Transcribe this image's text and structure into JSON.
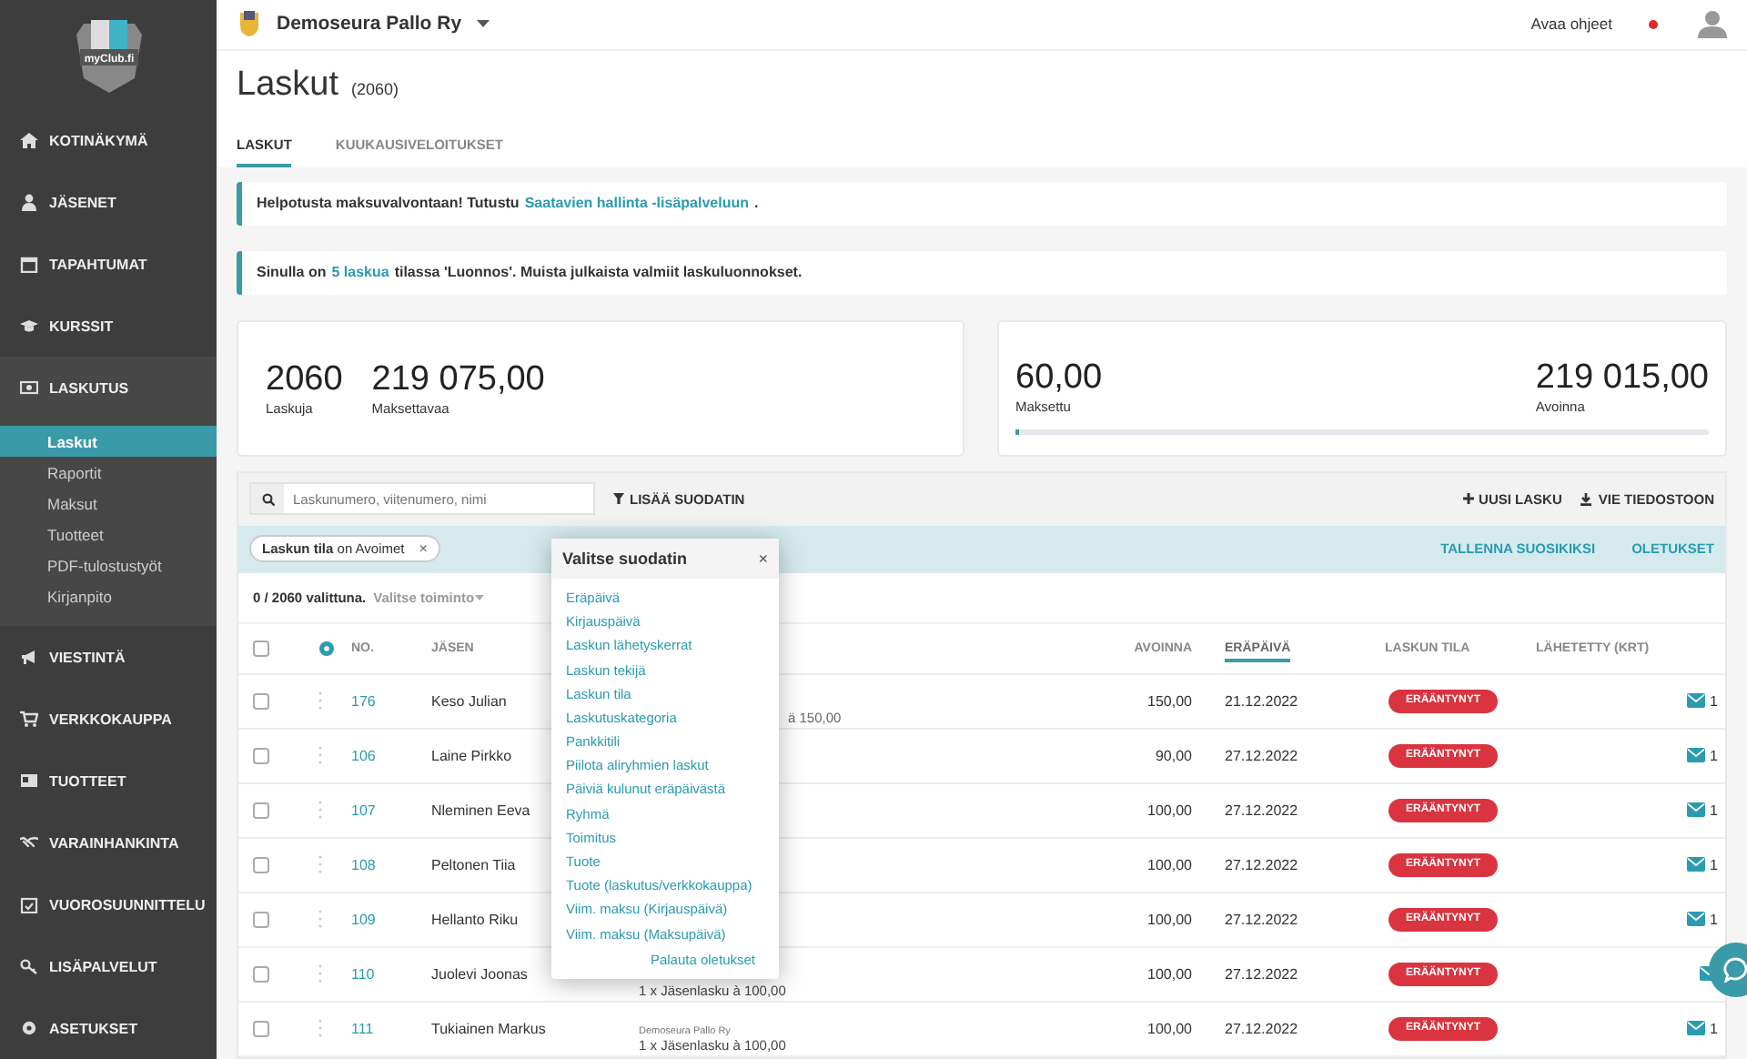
{
  "sidebar": {
    "logo_text": "myClub.fi",
    "items": [
      {
        "label": "KOTINÄKYMÄ"
      },
      {
        "label": "JÄSENET"
      },
      {
        "label": "TAPAHTUMAT"
      },
      {
        "label": "KURSSIT"
      },
      {
        "label": "LASKUTUS",
        "children": [
          {
            "label": "Laskut",
            "selected": true
          },
          {
            "label": "Raportit",
            "selected": false
          },
          {
            "label": "Maksut",
            "selected": false
          },
          {
            "label": "Tuotteet",
            "selected": false
          },
          {
            "label": "PDF-tulostustyöt",
            "selected": false
          },
          {
            "label": "Kirjanpito",
            "selected": false
          }
        ]
      },
      {
        "label": "VIESTINTÄ"
      },
      {
        "label": "VERKKOKAUPPA"
      },
      {
        "label": "TUOTTEET"
      },
      {
        "label": "VARAINHANKINTA"
      },
      {
        "label": "VUOROSUUNNITTELU"
      },
      {
        "label": "LISÄPALVELUT"
      },
      {
        "label": "ASETUKSET"
      }
    ]
  },
  "topbar": {
    "club": "Demoseura Pallo Ry",
    "help": "Avaa ohjeet"
  },
  "page": {
    "title": "Laskut",
    "count": "(2060)"
  },
  "tabs": [
    {
      "label": "LASKUT",
      "selected": true
    },
    {
      "label": "KUUKAUSIVELOITUKSET",
      "selected": false
    }
  ],
  "alerts": [
    {
      "text": "Helpotusta maksuvalvontaan! Tutustu",
      "link": "Saatavien hallinta -lisäpalveluun",
      "after": "."
    },
    {
      "text": "Sinulla on",
      "link": "5 laskua",
      "after": "tilassa 'Luonnos'. Muista julkaista valmiit laskuluonnokset."
    }
  ],
  "stats_left": [
    {
      "value": "2060",
      "label": "Laskuja"
    },
    {
      "value": "219 075,00",
      "label": "Maksettavaa"
    }
  ],
  "stats_right": {
    "paid": "60,00",
    "paid_label": "Maksettu",
    "open": "219 015,00",
    "open_label": "Avoinna",
    "level": 0
  },
  "toolbar": {
    "search_placeholder": "Laskunumero, viitenumero, nimi",
    "add_filter": "LISÄÄ SUODATIN",
    "new_invoice": "UUSI LASKU",
    "export": "VIE TIEDOSTOON"
  },
  "filter_chip": {
    "field": "Laskun tila",
    "value": "on Avoimet",
    "close": "×"
  },
  "filter_actions": [
    "TALLENNA SUOSIKIKSI",
    "OLETUKSET"
  ],
  "selection": {
    "text": "0 / 2060 valittuna.",
    "action": "Valitse toiminto"
  },
  "table": {
    "select_all_checked": false,
    "columns": [
      "NO.",
      "JÄSEN",
      "AVOINNA",
      "ERÄPÄIVÄ",
      "LASKUN TILA",
      "LÄHETETTY (KRT)"
    ],
    "rows": [
      {
        "no": "176",
        "member": "Keso Julian",
        "desc": [
          "ä 150,00"
        ],
        "desc_clipped": true,
        "open": "150,00",
        "due": "21.12.2022",
        "status": "ERÄÄNTYNYT",
        "sent": "1",
        "checked": false
      },
      {
        "no": "106",
        "member": "Laine Pirkko",
        "open": "90,00",
        "due": "27.12.2022",
        "status": "ERÄÄNTYNYT",
        "sent": "1",
        "checked": false
      },
      {
        "no": "107",
        "member": "Nleminen Eeva",
        "open": "100,00",
        "due": "27.12.2022",
        "status": "ERÄÄNTYNYT",
        "sent": "1",
        "checked": false
      },
      {
        "no": "108",
        "member": "Peltonen Tiia",
        "open": "100,00",
        "due": "27.12.2022",
        "status": "ERÄÄNTYNYT",
        "sent": "1",
        "checked": false
      },
      {
        "no": "109",
        "member": "Hellanto Riku",
        "open": "100,00",
        "due": "27.12.2022",
        "status": "ERÄÄNTYNYT",
        "sent": "1",
        "checked": false
      },
      {
        "no": "110",
        "member": "Juolevi Joonas",
        "desc": [
          "1 x Jäsenlasku à 100,00"
        ],
        "open": "100,00",
        "due": "27.12.2022",
        "status": "ERÄÄNTYNYT",
        "checked": false
      },
      {
        "no": "111",
        "member": "Tukiainen Markus",
        "desc": [
          "Demoseura Pallo Ry",
          "1 x Jäsenlasku à 100,00"
        ],
        "open": "100,00",
        "due": "27.12.2022",
        "status": "ERÄÄNTYNYT",
        "sent": "1",
        "checked": false
      }
    ]
  },
  "filter_popup": {
    "title": "Valitse suodatin",
    "close": "×",
    "options": [
      "Eräpäivä",
      "Kirjauspäivä",
      "Laskun lähetyskerrat",
      "Laskun tekijä",
      "Laskun tila",
      "Laskutuskategoria",
      "Pankkitili",
      "Piilota aliryhmien laskut",
      "Päiviä kulunut eräpäivästä",
      "Ryhmä",
      "Toimitus",
      "Tuote",
      "Tuote (laskutus/verkkokauppa)",
      "Viim. maksu (Kirjauspäivä)",
      "Viim. maksu (Maksupäivä)"
    ],
    "reset": "Palauta oletukset"
  }
}
